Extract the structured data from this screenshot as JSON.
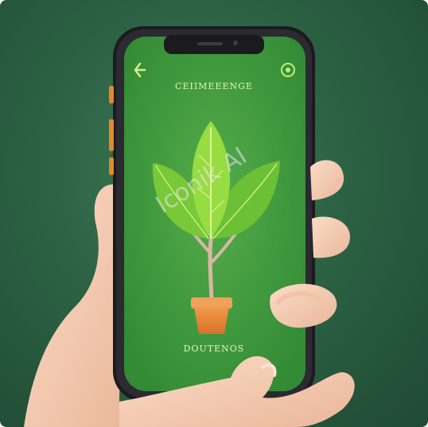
{
  "screen": {
    "title": "CEIIMEEENGE",
    "footer": "DOUTENOS",
    "back_glyph": "‹",
    "icon": "leaf-circle-icon"
  },
  "watermark": "Iconik AI",
  "colors": {
    "background": "#2c6244",
    "screen": "#3f9a3f",
    "pot": "#e8893a",
    "leaf": "#8ad63c",
    "skin": "#f6cdb3"
  }
}
